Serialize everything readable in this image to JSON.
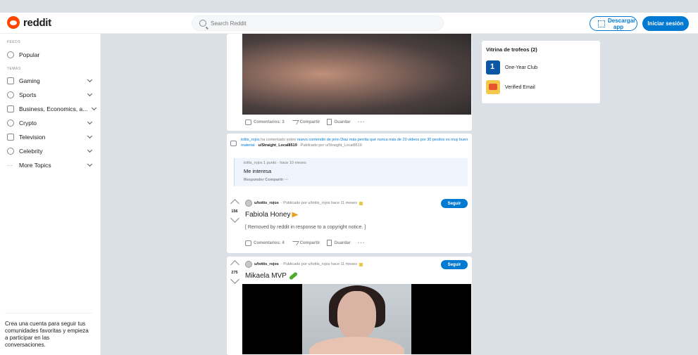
{
  "header": {
    "logo_text": "reddit",
    "search_placeholder": "Search Reddit",
    "app_button": "Descargar app",
    "login_button": "Iniciar sesión"
  },
  "sidebar": {
    "feeds_label": "FEEDS",
    "popular": "Popular",
    "topics_label": "TEMAS",
    "items": [
      {
        "label": "Gaming",
        "icon": "gamepad-icon"
      },
      {
        "label": "Sports",
        "icon": "sports-icon"
      },
      {
        "label": "Business, Economics, a...",
        "icon": "chart-icon"
      },
      {
        "label": "Crypto",
        "icon": "crypto-icon"
      },
      {
        "label": "Television",
        "icon": "tv-icon"
      },
      {
        "label": "Celebrity",
        "icon": "star-icon"
      },
      {
        "label": "More Topics",
        "icon": "more-icon"
      }
    ],
    "footer": "Crea una cuenta para seguir tus comunidades favoritas y empieza a participar en las conversaciones."
  },
  "post1": {
    "comments": "Comentarios: 3",
    "share": "Compartir",
    "save": "Guardar"
  },
  "comment": {
    "user": "tottis_rojos",
    "action": "ha comentado sobre",
    "post_title": "nuevo contendió de jenn Diaz más perrita qué nunca más de 20 videos por 30 pesitos es muy buen material",
    "dot": "·",
    "sub": "u/Straight_Local8519",
    "posted_by": "· Publicado por u/Straight_Local8519",
    "meta": "tottis_rojos 1 punto · hace 10 meses",
    "text": "Me interesa",
    "reply": "Responder",
    "share": "Compartir"
  },
  "post2": {
    "votes": "156",
    "user": "u/tottis_rojos",
    "meta": "· Publicado por u/tottis_rojos hace 11 meses",
    "follow": "Seguir",
    "title": "Fabiola Honey",
    "body": "[ Removed by reddit in response to a copyright notice. ]",
    "comments": "Comentarios: 4",
    "share": "Compartir",
    "save": "Guardar"
  },
  "post3": {
    "votes": "275",
    "user": "u/tottis_rojos",
    "meta": "· Publicado por u/tottis_rojos hace 11 meses",
    "follow": "Seguir",
    "title": "Mikaela MVP"
  },
  "trophies": {
    "title": "Vitrina de trofeos (2)",
    "items": [
      "One-Year Club",
      "Verified Email"
    ]
  },
  "colors": {
    "brand": "#ff4500",
    "accent": "#0079d3",
    "background": "#dae0e6"
  }
}
